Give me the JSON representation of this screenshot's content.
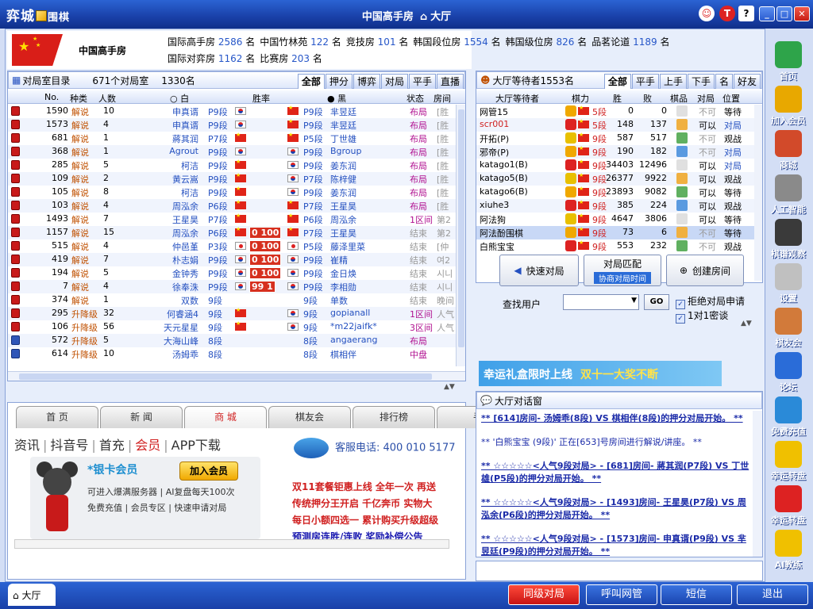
{
  "titlebar": {
    "logo_text": "弈城",
    "logo_suffix": "围棋",
    "title": "中国高手房",
    "breadcrumb": "大厅"
  },
  "room": {
    "name": "中国高手房",
    "links": [
      {
        "label": "国际高手房",
        "count": "2586",
        "unit": "名"
      },
      {
        "label": "中国竹林苑",
        "count": "122",
        "unit": "名"
      },
      {
        "label": "竞技房",
        "count": "101",
        "unit": "名"
      },
      {
        "label": "韩国段位房",
        "count": "1554",
        "unit": "名"
      },
      {
        "label": "韩国级位房",
        "count": "826",
        "unit": "名"
      },
      {
        "label": "品茗论道",
        "count": "1189",
        "unit": "名"
      },
      {
        "label": "国际对弈房",
        "count": "1162",
        "unit": "名"
      },
      {
        "label": "比赛房",
        "count": "203",
        "unit": "名"
      }
    ]
  },
  "rooms_panel": {
    "title": "对局室目录",
    "room_count": "671个对局室",
    "player_count": "1330名",
    "tabs": [
      "全部",
      "押分",
      "博弈",
      "对局",
      "平手",
      "直播"
    ],
    "columns": {
      "no": "No.",
      "type": "种类",
      "people": "人数",
      "white": "白",
      "rate": "胜率",
      "black": "黑",
      "status": "状态",
      "room": "房间"
    },
    "rows": [
      {
        "no": "1590",
        "type": "解说",
        "n": "10",
        "w": "申真谞",
        "wr": "P9段",
        "wf": "kr",
        "bf": "cn",
        "br": "P9段",
        "b": "芈昱廷",
        "st": "布局",
        "rm": "[胜"
      },
      {
        "no": "1573",
        "type": "解说",
        "n": "4",
        "w": "申真谞",
        "wr": "P9段",
        "wf": "kr",
        "bf": "cn",
        "br": "P9段",
        "b": "芈昱廷",
        "st": "布局",
        "rm": "[胜"
      },
      {
        "no": "681",
        "type": "解说",
        "n": "1",
        "w": "蔣其润",
        "wr": "P7段",
        "wf": "cn",
        "bf": "cn",
        "br": "P5段",
        "b": "丁世雄",
        "st": "布局",
        "rm": "[胜"
      },
      {
        "no": "368",
        "type": "解说",
        "n": "1",
        "w": "Agrout",
        "wr": "P9段",
        "wf": "kr",
        "bf": "kr",
        "br": "P9段",
        "b": "Bgroup",
        "st": "布局",
        "rm": "[胜"
      },
      {
        "no": "285",
        "type": "解说",
        "n": "5",
        "w": "柯洁",
        "wr": "P9段",
        "wf": "cn",
        "bf": "kr",
        "br": "P9段",
        "b": "姜东润",
        "st": "布局",
        "rm": "[胜"
      },
      {
        "no": "109",
        "type": "解说",
        "n": "2",
        "w": "黄云嵩",
        "wr": "P9段",
        "wf": "cn",
        "bf": "kr",
        "br": "P7段",
        "b": "陈梓健",
        "st": "布局",
        "rm": "[胜"
      },
      {
        "no": "105",
        "type": "解说",
        "n": "8",
        "w": "柯洁",
        "wr": "P9段",
        "wf": "cn",
        "bf": "kr",
        "br": "P9段",
        "b": "姜东润",
        "st": "布局",
        "rm": "[胜"
      },
      {
        "no": "103",
        "type": "解说",
        "n": "4",
        "w": "周泓余",
        "wr": "P6段",
        "wf": "cn",
        "bf": "cn",
        "br": "P7段",
        "b": "王星昊",
        "st": "布局",
        "rm": "[胜"
      },
      {
        "no": "1493",
        "type": "解说",
        "n": "7",
        "w": "王星昊",
        "wr": "P7段",
        "wf": "cn",
        "bf": "cn",
        "br": "P6段",
        "b": "周泓余",
        "st": "1区间",
        "rm": "第2"
      },
      {
        "no": "1157",
        "type": "解说",
        "n": "15",
        "w": "周泓余",
        "wr": "P6段",
        "wf": "cn",
        "rate": "0 100",
        "bf": "cn",
        "br": "P7段",
        "b": "王星昊",
        "st": "结束",
        "rm": "第2"
      },
      {
        "no": "515",
        "type": "解说",
        "n": "4",
        "w": "仲邑堇",
        "wr": "P3段",
        "wf": "jp",
        "rate": "0 100",
        "bf": "jp",
        "br": "P5段",
        "b": "藤泽里菜",
        "st": "结束",
        "rm": "[仲"
      },
      {
        "no": "419",
        "type": "解说",
        "n": "7",
        "w": "朴志娟",
        "wr": "P9段",
        "wf": "kr",
        "rate": "0 100",
        "bf": "kr",
        "br": "P9段",
        "b": "崔精",
        "st": "结束",
        "rm": "여2"
      },
      {
        "no": "194",
        "type": "解说",
        "n": "5",
        "w": "金钟秀",
        "wr": "P9段",
        "wf": "kr",
        "rate": "0 100",
        "bf": "kr",
        "br": "P9段",
        "b": "金日焕",
        "st": "结束",
        "rm": "시니"
      },
      {
        "no": "7",
        "type": "解说",
        "n": "4",
        "w": "徐奉洙",
        "wr": "P9段",
        "wf": "kr",
        "rate": "99 1",
        "bf": "kr",
        "br": "P9段",
        "b": "李相勋",
        "st": "结束",
        "rm": "시니"
      },
      {
        "no": "374",
        "type": "解说",
        "n": "1",
        "w": "双数",
        "wr": "9段",
        "wf": "",
        "bf": "",
        "br": "9段",
        "b": "单数",
        "st": "结束",
        "rm": "晚间"
      },
      {
        "no": "295",
        "type": "升降级",
        "n": "32",
        "w": "何睿涵4",
        "wr": "9段",
        "wf": "cn",
        "bf": "kr",
        "br": "9段",
        "b": "gopianall",
        "st": "1区间",
        "rm": "人气"
      },
      {
        "no": "106",
        "type": "升降级",
        "n": "56",
        "w": "天元星星",
        "wr": "9段",
        "wf": "cn",
        "bf": "kr",
        "br": "9段",
        "b": "*m22jaifk*",
        "st": "3区间",
        "rm": "人气"
      },
      {
        "no": "572",
        "type": "升降级",
        "n": "5",
        "w": "大海山峰",
        "wr": "8段",
        "wf": "",
        "bf": "",
        "br": "8段",
        "b": "angaerang",
        "st": "布局",
        "rm": ""
      },
      {
        "no": "614",
        "type": "升降级",
        "n": "10",
        "w": "汤姆乖",
        "wr": "8段",
        "wf": "",
        "bf": "",
        "br": "8段",
        "b": "棋相伴",
        "st": "中盘",
        "rm": ""
      }
    ]
  },
  "waiting_panel": {
    "title": "大厅等待者1553名",
    "tabs": [
      "全部",
      "平手",
      "上手",
      "下手",
      "名",
      "好友"
    ],
    "columns": {
      "name": "大厅等待者",
      "rank": "棋力",
      "win": "胜",
      "lose": "败",
      "manner": "棋品",
      "game": "对局",
      "pos": "位置"
    },
    "rows": [
      {
        "name": "网管15",
        "rank": "5段",
        "w": "0",
        "l": "0",
        "g": "不可",
        "p": "等待"
      },
      {
        "name": "scr001",
        "rank": "5段",
        "w": "148",
        "l": "137",
        "g": "可以",
        "p": "对局"
      },
      {
        "name": "开拓(P)",
        "rank": "9段",
        "w": "587",
        "l": "517",
        "g": "不可",
        "p": "观战"
      },
      {
        "name": "邪帝(P)",
        "rank": "9段",
        "w": "190",
        "l": "182",
        "g": "不可",
        "p": "对局"
      },
      {
        "name": "katago1(B)",
        "rank": "9段",
        "w": "34403",
        "l": "12496",
        "g": "可以",
        "p": "对局"
      },
      {
        "name": "katago5(B)",
        "rank": "9段",
        "w": "26377",
        "l": "9922",
        "g": "可以",
        "p": "观战"
      },
      {
        "name": "katago6(B)",
        "rank": "9段",
        "w": "23893",
        "l": "9082",
        "g": "可以",
        "p": "等待"
      },
      {
        "name": "xiuhe3",
        "rank": "9段",
        "w": "385",
        "l": "224",
        "g": "可以",
        "p": "观战"
      },
      {
        "name": "阿法狗",
        "rank": "9段",
        "w": "4647",
        "l": "3806",
        "g": "可以",
        "p": "等待"
      },
      {
        "name": "阿法酚围棋",
        "rank": "9段",
        "w": "73",
        "l": "6",
        "g": "不可",
        "p": "等待"
      },
      {
        "name": "白熊宝宝",
        "rank": "9段",
        "w": "553",
        "l": "232",
        "g": "不可",
        "p": "观战"
      }
    ]
  },
  "controls": {
    "quick": "快速对局",
    "match": "对局匹配",
    "match_sub": "协商对局时间",
    "create": "创建房间",
    "search_label": "查找用户",
    "go": "GO",
    "chk1": "拒绝对局申请",
    "chk2": "1对1密谈"
  },
  "banner": {
    "text1": "幸运礼盒限时上线",
    "text2": "双十一大奖不断"
  },
  "chat": {
    "title": "大厅对话窗",
    "lines": [
      "** [614]房间- 汤姆乖(8段) VS 棋相伴(8段)的押分对局开始。 **",
      "** '白熊宝宝 (9段)' 正在[653]号房间进行解说/讲座。 **",
      "** ☆☆☆☆☆<人气9段对局> - [681]房间- 蔣其润(P7段) VS 丁世雄(P5段)的押分对局开始。 **",
      "** ☆☆☆☆☆<人气9段对局> - [1493]房间- 王星昊(P7段) VS 周泓余(P6段)的押分对局开始。 **",
      "** ☆☆☆☆☆<人气9段对局> - [1573]房间- 申真谞(P9段) VS 芈昱廷(P9段)的押分对局开始。 **"
    ]
  },
  "news": {
    "tabs": [
      "首 页",
      "新 闻",
      "商 城",
      "棋友会",
      "排行榜",
      "手"
    ],
    "sublinks": [
      "资讯",
      "抖音号",
      "首充",
      "会员",
      "APP下载"
    ],
    "vip_title": "*银卡会员",
    "vip_join": "加入会员",
    "vip_l1": "可进入爆满服务器 | AI复盘每天100次",
    "vip_l2": "免费充值 | 会员专区 | 快速申请对局",
    "phone": "客服电话: 400 010 5177",
    "promo": [
      "双11套餐钜惠上线  全年一次  再送",
      "传统押分王开启  千亿奔币  实物大",
      "每日小额四选一  累计购买升级超级",
      "预测房连胜/连败  奖励补偿公告"
    ]
  },
  "sidebar": [
    "首页",
    "加入会员",
    "商城",
    "人工智能",
    "棋谱观察",
    "设置",
    "棋友会",
    "论坛",
    "免费充值",
    "幸运转盘",
    "幸运转盘",
    "AI教练"
  ],
  "bottom": {
    "hall": "大厅",
    "b1": "同级对局",
    "b2": "呼叫网管",
    "b3": "短信",
    "b4": "退出"
  },
  "colors": {
    "titlebar": "#1940a8",
    "accent_red": "#d02020",
    "link_blue": "#2450c0",
    "panel_bg": "#e7eefb"
  }
}
